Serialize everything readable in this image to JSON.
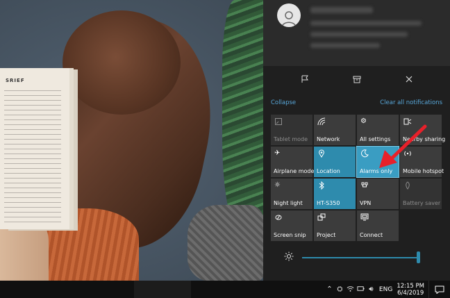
{
  "wallpaper": {
    "book_heading": "SRIEF"
  },
  "action_center": {
    "collapse_label": "Collapse",
    "clear_all_label": "Clear all notifications",
    "tiles": [
      {
        "label": "Tablet mode",
        "icon": "tablet-mode-icon",
        "state": "off"
      },
      {
        "label": "Network",
        "icon": "network-icon",
        "state": "normal"
      },
      {
        "label": "All settings",
        "icon": "gear-icon",
        "state": "normal"
      },
      {
        "label": "Nearby sharing",
        "icon": "nearby-sharing-icon",
        "state": "normal"
      },
      {
        "label": "Airplane mode",
        "icon": "airplane-icon",
        "state": "normal"
      },
      {
        "label": "Location",
        "icon": "location-icon",
        "state": "on"
      },
      {
        "label": "Alarms only",
        "icon": "moon-icon",
        "state": "selected"
      },
      {
        "label": "Mobile hotspot",
        "icon": "hotspot-icon",
        "state": "normal"
      },
      {
        "label": "Night light",
        "icon": "night-light-icon",
        "state": "normal"
      },
      {
        "label": "HT-S350",
        "icon": "bluetooth-icon",
        "state": "on"
      },
      {
        "label": "VPN",
        "icon": "vpn-icon",
        "state": "normal"
      },
      {
        "label": "Battery saver",
        "icon": "battery-saver-icon",
        "state": "off"
      },
      {
        "label": "Screen snip",
        "icon": "screen-snip-icon",
        "state": "normal"
      },
      {
        "label": "Project",
        "icon": "project-icon",
        "state": "normal"
      },
      {
        "label": "Connect",
        "icon": "connect-icon",
        "state": "normal"
      }
    ],
    "brightness": {
      "icon": "brightness-icon",
      "level": 1.0
    }
  },
  "taskbar": {
    "language": "ENG",
    "time": "12:15 PM",
    "date": "6/4/2019",
    "tray_icons": [
      "chevron-up-icon",
      "defender-icon",
      "wifi-icon",
      "battery-icon",
      "volume-icon"
    ]
  },
  "colors": {
    "accent": "#2e8bad",
    "link": "#58a7d9",
    "panel": "#1f1f1f",
    "arrow": "#e8202a"
  }
}
